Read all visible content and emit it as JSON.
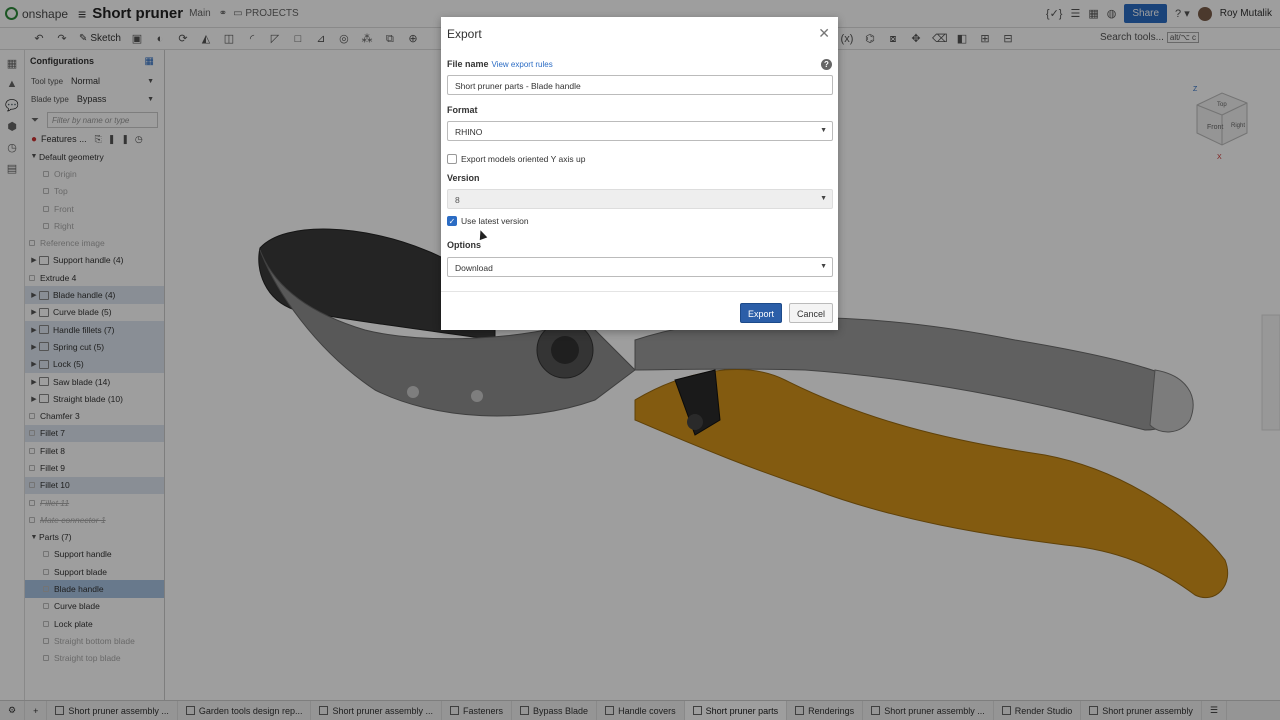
{
  "topbar": {
    "logo_text": "onshape",
    "document_title": "Short pruner",
    "branch": "Main",
    "projects_label": "PROJECTS",
    "share_label": "Share",
    "user_name": "Roy Mutalik"
  },
  "toolbar": {
    "sketch_label": "Sketch",
    "search_placeholder": "Search tools...",
    "search_shortcut": "alt/⌥ c"
  },
  "panel": {
    "configurations_label": "Configurations",
    "config_rows": [
      {
        "label": "Tool type",
        "value": "Normal"
      },
      {
        "label": "Blade type",
        "value": "Bypass"
      }
    ],
    "filter_placeholder": "Filter by name or type",
    "features_label": "Features ...",
    "tree": [
      {
        "label": "Default geometry",
        "kind": "group",
        "state": "normal"
      },
      {
        "label": "Origin",
        "kind": "dim-child",
        "state": "dim"
      },
      {
        "label": "Top",
        "kind": "dim-child",
        "state": "dim"
      },
      {
        "label": "Front",
        "kind": "dim-child",
        "state": "dim"
      },
      {
        "label": "Right",
        "kind": "dim-child",
        "state": "dim"
      },
      {
        "label": "Reference image",
        "kind": "item",
        "state": "dim"
      },
      {
        "label": "Support handle (4)",
        "kind": "folder",
        "state": "normal"
      },
      {
        "label": "Extrude 4",
        "kind": "item",
        "state": "normal"
      },
      {
        "label": "Blade handle (4)",
        "kind": "folder",
        "state": "highlight"
      },
      {
        "label": "Curve blade (5)",
        "kind": "folder",
        "state": "normal"
      },
      {
        "label": "Handle fillets (7)",
        "kind": "folder",
        "state": "highlight"
      },
      {
        "label": "Spring cut (5)",
        "kind": "folder",
        "state": "highlight"
      },
      {
        "label": "Lock (5)",
        "kind": "folder",
        "state": "highlight"
      },
      {
        "label": "Saw blade (14)",
        "kind": "folder",
        "state": "normal"
      },
      {
        "label": "Straight blade (10)",
        "kind": "folder",
        "state": "normal"
      },
      {
        "label": "Chamfer 3",
        "kind": "item",
        "state": "normal"
      },
      {
        "label": "Fillet 7",
        "kind": "item",
        "state": "highlight"
      },
      {
        "label": "Fillet 8",
        "kind": "item",
        "state": "normal"
      },
      {
        "label": "Fillet 9",
        "kind": "item",
        "state": "normal"
      },
      {
        "label": "Fillet 10",
        "kind": "item",
        "state": "highlight"
      },
      {
        "label": "Fillet 11",
        "kind": "item",
        "state": "strike"
      },
      {
        "label": "Mate connector 1",
        "kind": "item",
        "state": "strike"
      },
      {
        "label": "Parts (7)",
        "kind": "group",
        "state": "normal"
      },
      {
        "label": "Support handle",
        "kind": "part",
        "state": "normal"
      },
      {
        "label": "Support blade",
        "kind": "part",
        "state": "normal"
      },
      {
        "label": "Blade handle",
        "kind": "part",
        "state": "selected"
      },
      {
        "label": "Curve blade",
        "kind": "part",
        "state": "normal"
      },
      {
        "label": "Lock plate",
        "kind": "part",
        "state": "normal"
      },
      {
        "label": "Straight bottom blade",
        "kind": "part",
        "state": "dim"
      },
      {
        "label": "Straight top blade",
        "kind": "part",
        "state": "dim"
      }
    ]
  },
  "viewcube": {
    "face_front": "Front",
    "face_right": "Right",
    "face_top": "Top",
    "axis_z": "Z",
    "axis_x": "X"
  },
  "dialog": {
    "title": "Export",
    "file_name_label": "File name",
    "view_export_rules": "View export rules",
    "file_name_value": "Short pruner parts - Blade handle",
    "format_label": "Format",
    "format_value": "RHINO",
    "y_axis_up_label": "Export models oriented Y axis up",
    "y_axis_up_checked": false,
    "version_label": "Version",
    "version_value": "8",
    "use_latest_label": "Use latest version",
    "use_latest_checked": true,
    "options_label": "Options",
    "options_value": "Download",
    "export_button": "Export",
    "cancel_button": "Cancel"
  },
  "tabs": [
    {
      "label": "Short pruner assembly",
      "active": false
    },
    {
      "label": "Render Studio",
      "active": false
    },
    {
      "label": "Short pruner assembly ...",
      "active": false
    },
    {
      "label": "Renderings",
      "active": false
    },
    {
      "label": "Short pruner parts",
      "active": true
    },
    {
      "label": "Handle covers",
      "active": false
    },
    {
      "label": "Bypass Blade",
      "active": false
    },
    {
      "label": "Fasteners",
      "active": false
    },
    {
      "label": "Short pruner assembly ...",
      "active": false
    },
    {
      "label": "Garden tools design rep...",
      "active": false
    },
    {
      "label": "Short pruner assembly ...",
      "active": false
    }
  ],
  "colors": {
    "accent": "#2b6cc4",
    "part_yellow": "#e8a21a",
    "part_dark": "#3a3a3a",
    "part_gray": "#9a9a9a"
  }
}
